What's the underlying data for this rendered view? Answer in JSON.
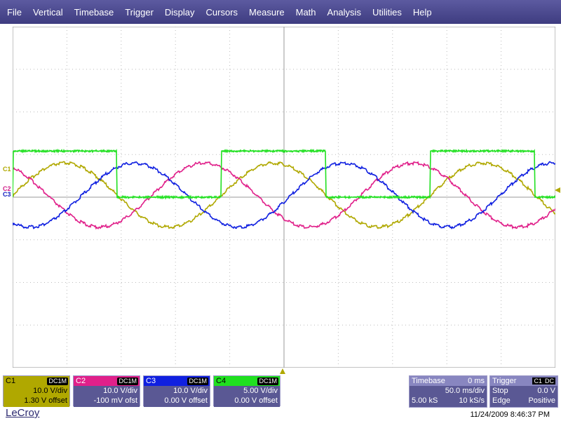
{
  "menu": [
    "File",
    "Vertical",
    "Timebase",
    "Trigger",
    "Display",
    "Cursors",
    "Measure",
    "Math",
    "Analysis",
    "Utilities",
    "Help"
  ],
  "levels": {
    "c1": "C1",
    "c2": "C2",
    "c3": "C3"
  },
  "channels": [
    {
      "label": "C1",
      "coupling": "DC1M",
      "scale": "10.0 V/div",
      "offset": "1.30 V offset",
      "color": "#b0a800"
    },
    {
      "label": "C2",
      "coupling": "DC1M",
      "scale": "10.0 V/div",
      "offset": "-100 mV ofst",
      "color": "#e0208a"
    },
    {
      "label": "C3",
      "coupling": "DC1M",
      "scale": "10.0 V/div",
      "offset": "0.00 V offset",
      "color": "#1020e0"
    },
    {
      "label": "C4",
      "coupling": "DC1M",
      "scale": "5.00 V/div",
      "offset": "0.00 V offset",
      "color": "#20e020"
    }
  ],
  "timebase": {
    "title": "Timebase",
    "delay": "0 ms",
    "scale": "50.0 ms/div",
    "samples": "5.00 kS",
    "rate": "10 kS/s"
  },
  "trigger": {
    "title": "Trigger",
    "source": "C1",
    "coupling": "DC",
    "mode": "Stop",
    "level": "0.0 V",
    "type": "Edge",
    "slope": "Positive"
  },
  "logo": "LeCroy",
  "datetime": "11/24/2009 8:46:37 PM",
  "waveforms": {
    "period_divs": 3.85,
    "c1": {
      "color": "#b0a800",
      "amplitude_divs": 0.75,
      "phase": 0.0
    },
    "c2": {
      "color": "#e0208a",
      "amplitude_divs": 0.75,
      "phase": 2.094
    },
    "c3": {
      "color": "#1020e0",
      "amplitude_divs": 0.75,
      "phase": 4.189
    },
    "c4": {
      "color": "#20e020",
      "high_divs": 1.0,
      "low_divs": 0.0
    }
  }
}
